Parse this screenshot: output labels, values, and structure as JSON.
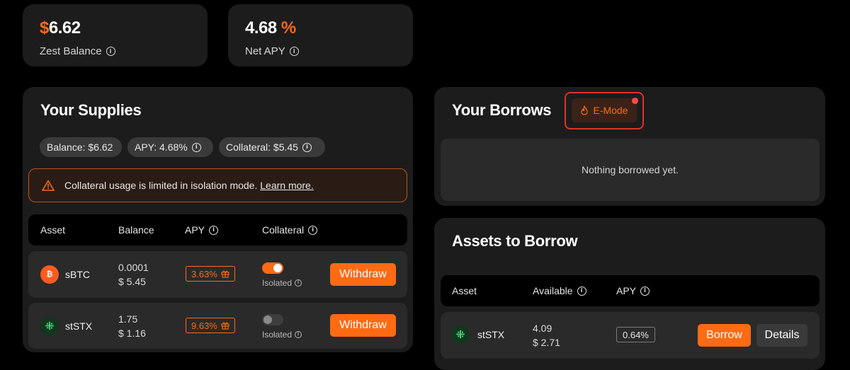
{
  "stats": {
    "balance": {
      "currency": "$",
      "value": "6.62",
      "label": "Zest Balance"
    },
    "apy": {
      "value": "4.68",
      "unit": "%",
      "label": "Net APY"
    }
  },
  "supplies": {
    "title": "Your Supplies",
    "pills": {
      "balance": "Balance:  $6.62",
      "apy": "APY:  4.68%",
      "collateral": "Collateral:  $5.45"
    },
    "warning": {
      "text": "Collateral usage is limited in isolation mode.",
      "link": "Learn more."
    },
    "headers": {
      "asset": "Asset",
      "balance": "Balance",
      "apy": "APY",
      "collateral": "Collateral"
    },
    "rows": [
      {
        "symbol": "sBTC",
        "icon": "bitcoin-icon",
        "amount": "0.0001",
        "usd": "$ 5.45",
        "apy": "3.63%",
        "collateral_on": true,
        "collateral_label": "Isolated",
        "action": "Withdraw"
      },
      {
        "symbol": "stSTX",
        "icon": "stacks-icon",
        "amount": "1.75",
        "usd": "$ 1.16",
        "apy": "9.63%",
        "collateral_on": false,
        "collateral_label": "Isolated",
        "action": "Withdraw"
      }
    ]
  },
  "borrows": {
    "title": "Your Borrows",
    "emode_label": "E-Mode",
    "empty_text": "Nothing borrowed yet."
  },
  "assets_to_borrow": {
    "title": "Assets to Borrow",
    "headers": {
      "asset": "Asset",
      "available": "Available",
      "apy": "APY"
    },
    "rows": [
      {
        "symbol": "stSTX",
        "icon": "stacks-icon",
        "amount": "4.09",
        "usd": "$ 2.71",
        "apy": "0.64%",
        "borrow_label": "Borrow",
        "details_label": "Details"
      }
    ]
  },
  "colors": {
    "accent": "#ff6a13",
    "card": "#1c1c1c",
    "row": "#2a2a2a",
    "alert": "#e2302a"
  }
}
